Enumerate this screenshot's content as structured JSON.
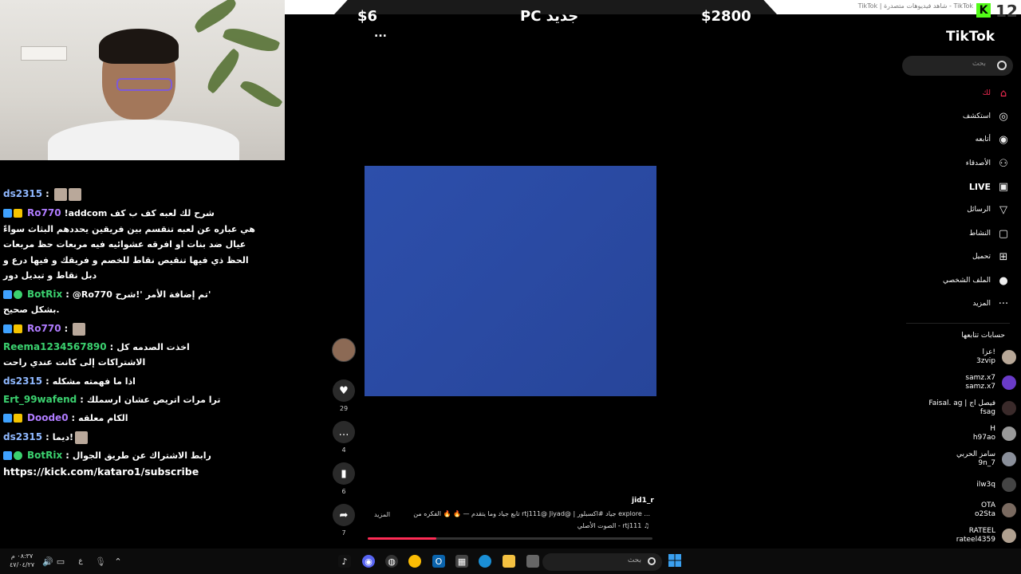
{
  "browser": {
    "tab_title": "TikTok | شاهد فيديوهات متصدرة - TikTok",
    "kick_logo": "K",
    "overlay_number": "12"
  },
  "pricebar": {
    "left_price": "$6",
    "center_label": "PC جديد",
    "right_price": "$2800"
  },
  "chat": {
    "messages": [
      {
        "user": "ds2315",
        "sep": " : ",
        "text": ""
      },
      {
        "user": "Ro770",
        "sep": " ",
        "text": "!addcom شرح لك لعبه كف ب كف"
      },
      {
        "user": "",
        "sep": "",
        "text": "هي عباره عن لعبه تنقسم بين فريقين يحددهم البثاث سواءً"
      },
      {
        "user": "",
        "sep": "",
        "text": "عيال ضد بنات او افرقه عشوائيه فيه مربعات حظ مربعات"
      },
      {
        "user": "",
        "sep": "",
        "text": "الحظ ذي فيها تنقيص نقاط للخصم و فريقك و فيها درع و"
      },
      {
        "user": "",
        "sep": "",
        "text": "دبل نقاط و تبديل دور"
      },
      {
        "user": "BotRix",
        "sep": " : ",
        "text": "@Ro770 تم إضافة الأمر '!شرح'"
      },
      {
        "user": "",
        "sep": "",
        "text": "بشكل صحيح."
      },
      {
        "user": "Ro770",
        "sep": " : ",
        "text": ""
      },
      {
        "user": "Reema1234567890",
        "sep": " : ",
        "text": "اخذت الصدمه كل"
      },
      {
        "user": "",
        "sep": "",
        "text": "الاشتراكات إلى كانت عندي راحت"
      },
      {
        "user": "ds2315",
        "sep": " : ",
        "text": "اذا ما فهمته مشكله"
      },
      {
        "user": "Ert_99wafend",
        "sep": " : ",
        "text": "ترا مرات اتريص عشان ارسملك"
      },
      {
        "user": "Doode0",
        "sep": " : ",
        "text": "الكام معلقه"
      },
      {
        "user": "ds2315",
        "sep": " : ",
        "text": "ديما!"
      },
      {
        "user": "BotRix",
        "sep": " : ",
        "text": "رابط الاشتراك عن طريق الجوال"
      }
    ],
    "subscribe_link": "https://kick.com/kataro1/subscribe"
  },
  "tiktok": {
    "logo": "TikTok",
    "search_placeholder": "بحث",
    "nav": [
      {
        "label": "لك",
        "icon": "home-icon"
      },
      {
        "label": "استكشف",
        "icon": "compass-icon"
      },
      {
        "label": "أتابعه",
        "icon": "following-icon"
      },
      {
        "label": "الأصدقاء",
        "icon": "friends-icon"
      },
      {
        "label": "LIVE",
        "icon": "live-icon"
      },
      {
        "label": "الرسائل",
        "icon": "send-icon"
      },
      {
        "label": "النشاط",
        "icon": "activity-icon"
      },
      {
        "label": "تحميل",
        "icon": "upload-icon"
      },
      {
        "label": "الملف الشخصي",
        "icon": "profile-icon"
      },
      {
        "label": "المزيد",
        "icon": "more-icon"
      }
    ],
    "following_heading": "حسابات تتابعها",
    "following": [
      {
        "name": "عزا!",
        "handle": "3zvip"
      },
      {
        "name": "samz.x7",
        "handle": "samz.x7"
      },
      {
        "name": "Faisal. ag | فيصل اج",
        "handle": "fsag"
      },
      {
        "name": "H",
        "handle": "h97ao"
      },
      {
        "name": "سامز الحربي",
        "handle": "9n_7"
      },
      {
        "name": "",
        "handle": "ilw3q"
      },
      {
        "name": "OTA",
        "handle": "o2Sta"
      },
      {
        "name": "RATEEL",
        "handle": "rateel4359"
      }
    ],
    "video": {
      "username": "jid1_r",
      "description": "تابع جياد وما يتقدم — 🔥 🔥 الفكره من rtj111@    Jiyad@ | جياد  #اكسبلور  explore  ...",
      "more": "المزيد",
      "sound": "الصوت الأصلي - rtj111 ♫",
      "progress": 0.24,
      "likes": "29",
      "comments": "4",
      "saves": "6",
      "shares": "7",
      "more_dots": "..."
    }
  },
  "taskbar": {
    "search_placeholder": "بحث",
    "time": "٠٨:٣٧ م",
    "date": "٤٧/٠٤/٢٧",
    "lang": "ع"
  },
  "colors": {
    "accent": "#fe2c55",
    "kick": "#53fc18",
    "video_bg": "#2a4da8",
    "user_blue": "#8fb8ff",
    "user_purple": "#b07cff",
    "user_green": "#3bd16f",
    "user_yellow": "#f4d03f"
  }
}
